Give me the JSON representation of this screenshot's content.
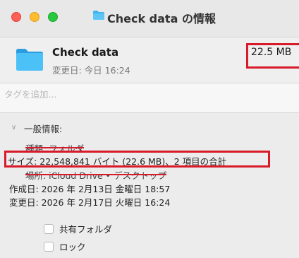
{
  "window": {
    "title": "Check data の情報"
  },
  "header": {
    "name": "Check data",
    "modified": "変更日: 今日 16:24",
    "size": "22.5 MB"
  },
  "tags": {
    "placeholder": "タグを追加..."
  },
  "general": {
    "title": "一般情報:",
    "kind": "種類: フォルダ",
    "size": "サイズ: 22,548,841 バイト (22.6 MB)、2 項目の合計",
    "where": "場所: iCloud Drive • デスクトップ",
    "created": "作成日: 2026 年 2月13日 金曜日 18:57",
    "modified": "変更日: 2026 年 2月17日 火曜日 16:24",
    "shared_folder": "共有フォルダ",
    "locked": "ロック"
  },
  "colors": {
    "highlight": "#d91a2a",
    "folder": "#38b6f4"
  }
}
